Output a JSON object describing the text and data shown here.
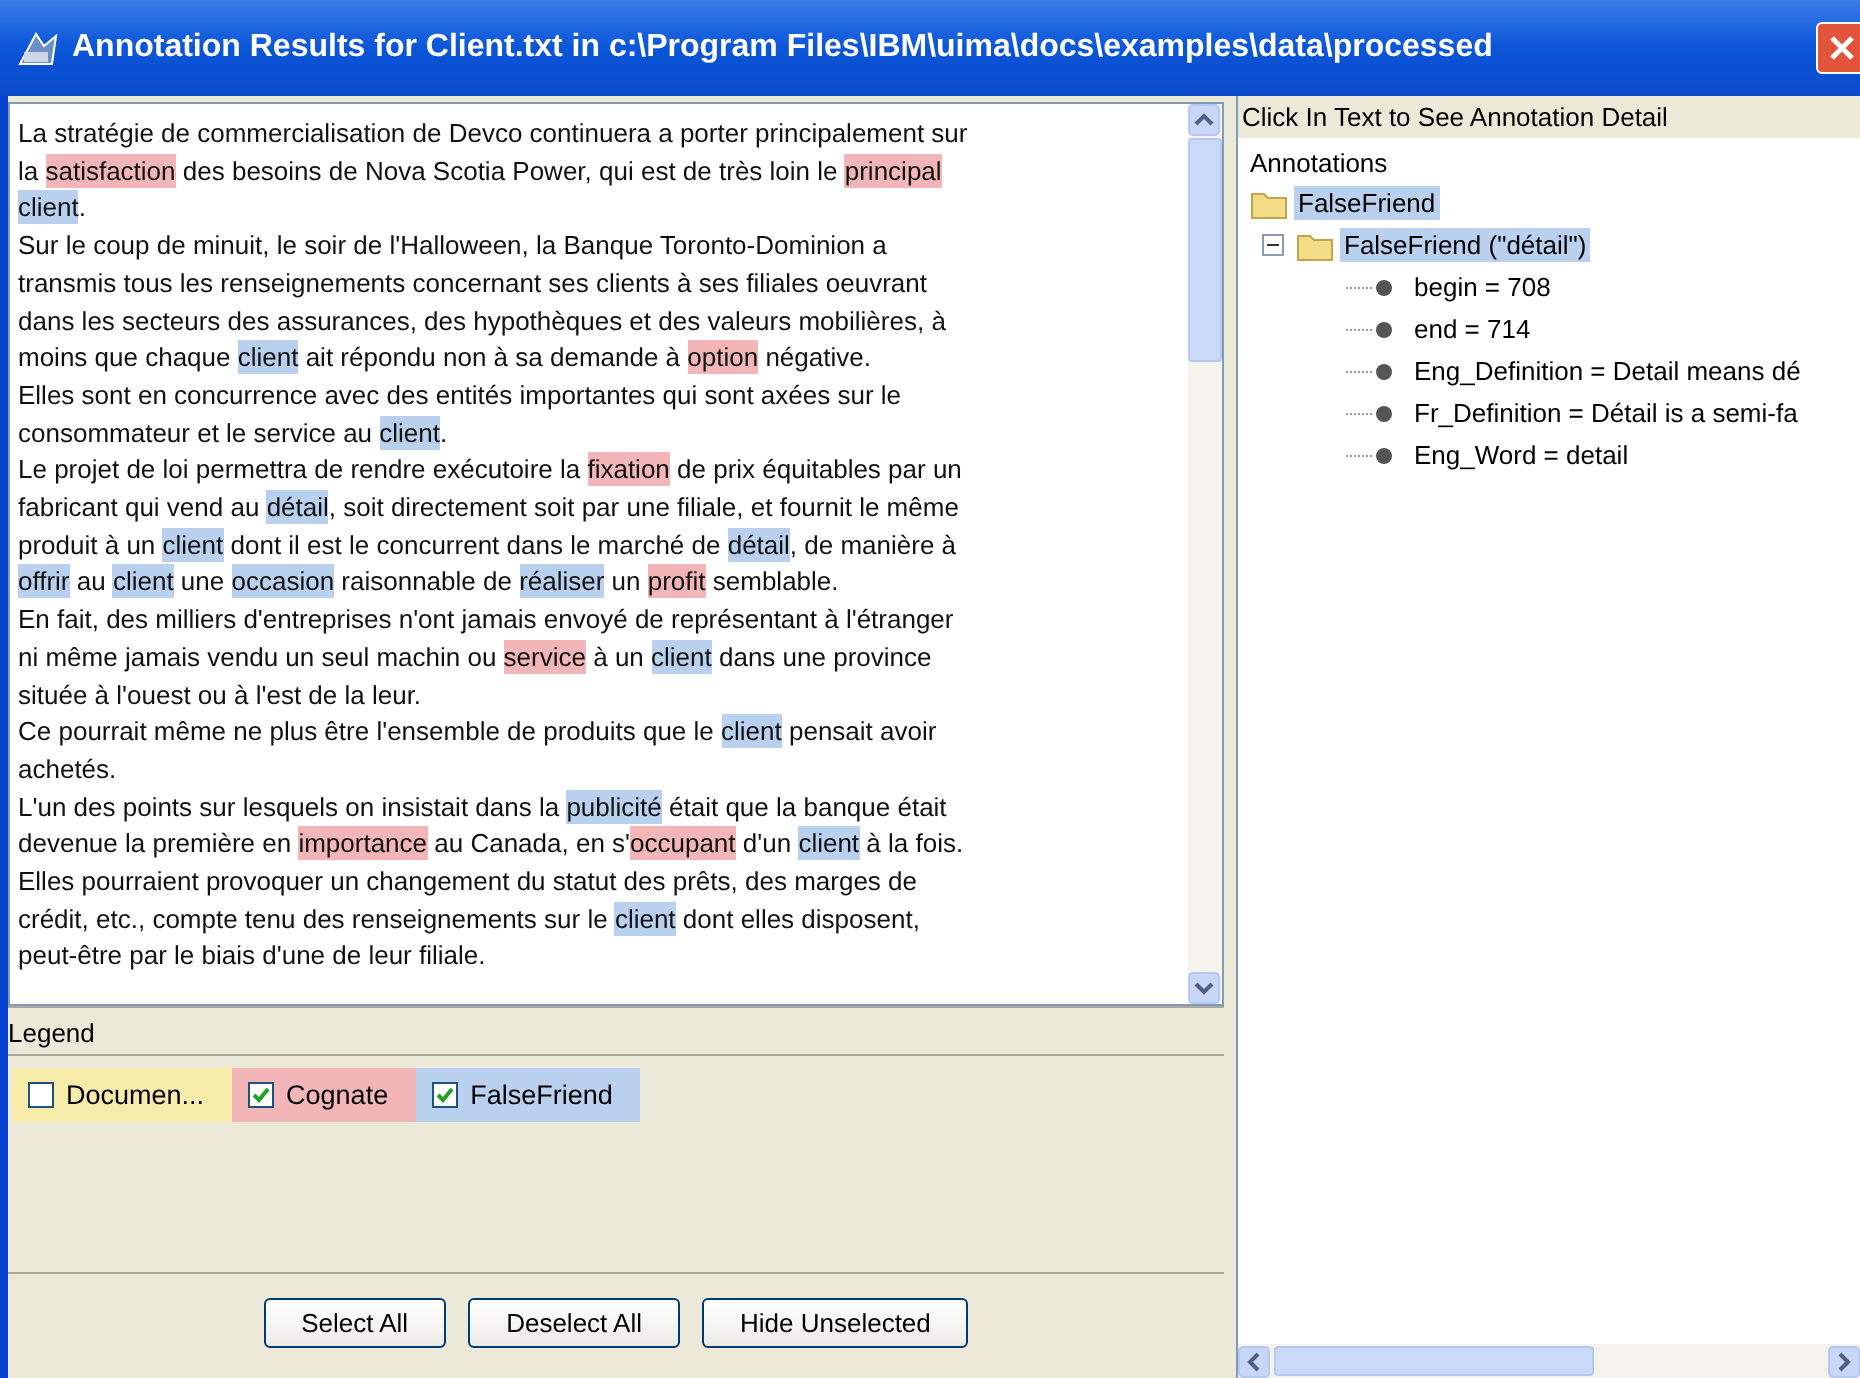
{
  "window": {
    "title": "Annotation Results for Client.txt in c:\\Program Files\\IBM\\uima\\docs\\examples\\data\\processed"
  },
  "document": {
    "lines": [
      [
        {
          "text": "La stratégie de commercialisation de Devco continuera a porter principalement sur",
          "kind": "plain"
        }
      ],
      [
        {
          "text": "la ",
          "kind": "plain"
        },
        {
          "text": "satisfaction",
          "kind": "cognate"
        },
        {
          "text": " des besoins de Nova Scotia Power, qui est de très loin le ",
          "kind": "plain"
        },
        {
          "text": "principal",
          "kind": "cognate"
        }
      ],
      [
        {
          "text": "client",
          "kind": "false_friend"
        },
        {
          "text": ".",
          "kind": "plain"
        }
      ],
      [
        {
          "text": "Sur le coup de minuit, le soir de l'Halloween, la Banque Toronto-Dominion a",
          "kind": "plain"
        }
      ],
      [
        {
          "text": "transmis tous les renseignements concernant ses clients à ses filiales oeuvrant",
          "kind": "plain"
        }
      ],
      [
        {
          "text": "dans les secteurs des assurances, des hypothèques et des valeurs mobilières, à",
          "kind": "plain"
        }
      ],
      [
        {
          "text": "moins que chaque ",
          "kind": "plain"
        },
        {
          "text": "client",
          "kind": "false_friend"
        },
        {
          "text": " ait répondu non à sa demande à ",
          "kind": "plain"
        },
        {
          "text": "option",
          "kind": "cognate"
        },
        {
          "text": " négative.",
          "kind": "plain"
        }
      ],
      [
        {
          "text": "Elles sont en concurrence avec des entités importantes qui sont axées sur le",
          "kind": "plain"
        }
      ],
      [
        {
          "text": "consommateur et le service au ",
          "kind": "plain"
        },
        {
          "text": "client",
          "kind": "false_friend"
        },
        {
          "text": ".",
          "kind": "plain"
        }
      ],
      [
        {
          "text": "Le projet de loi permettra de rendre exécutoire la ",
          "kind": "plain"
        },
        {
          "text": "fixation",
          "kind": "cognate"
        },
        {
          "text": " de prix équitables par un",
          "kind": "plain"
        }
      ],
      [
        {
          "text": "fabricant qui vend au ",
          "kind": "plain"
        },
        {
          "text": "détail",
          "kind": "false_friend"
        },
        {
          "text": ", soit directement soit par une filiale, et fournit le même",
          "kind": "plain"
        }
      ],
      [
        {
          "text": "produit à un ",
          "kind": "plain"
        },
        {
          "text": "client",
          "kind": "false_friend"
        },
        {
          "text": " dont il est le concurrent dans le marché de ",
          "kind": "plain"
        },
        {
          "text": "détail",
          "kind": "false_friend"
        },
        {
          "text": ", de manière à",
          "kind": "plain"
        }
      ],
      [
        {
          "text": "offrir",
          "kind": "false_friend"
        },
        {
          "text": " au ",
          "kind": "plain"
        },
        {
          "text": "client",
          "kind": "false_friend"
        },
        {
          "text": " une ",
          "kind": "plain"
        },
        {
          "text": "occasion",
          "kind": "false_friend"
        },
        {
          "text": " raisonnable de ",
          "kind": "plain"
        },
        {
          "text": "réaliser",
          "kind": "false_friend"
        },
        {
          "text": " un ",
          "kind": "plain"
        },
        {
          "text": "profit",
          "kind": "cognate"
        },
        {
          "text": " semblable.",
          "kind": "plain"
        }
      ],
      [
        {
          "text": "En fait, des milliers d'entreprises n'ont jamais envoyé de représentant à l'étranger",
          "kind": "plain"
        }
      ],
      [
        {
          "text": "ni même jamais vendu un seul machin ou ",
          "kind": "plain"
        },
        {
          "text": "service",
          "kind": "cognate"
        },
        {
          "text": " à un ",
          "kind": "plain"
        },
        {
          "text": "client",
          "kind": "false_friend"
        },
        {
          "text": " dans une province",
          "kind": "plain"
        }
      ],
      [
        {
          "text": "située à l'ouest ou à l'est de la leur.",
          "kind": "plain"
        }
      ],
      [
        {
          "text": "Ce pourrait même ne plus être l'ensemble de produits que le ",
          "kind": "plain"
        },
        {
          "text": "client",
          "kind": "false_friend"
        },
        {
          "text": " pensait avoir",
          "kind": "plain"
        }
      ],
      [
        {
          "text": "achetés.",
          "kind": "plain"
        }
      ],
      [
        {
          "text": "L'un des points sur lesquels on insistait dans la ",
          "kind": "plain"
        },
        {
          "text": "publicité",
          "kind": "false_friend"
        },
        {
          "text": " était que la banque était",
          "kind": "plain"
        }
      ],
      [
        {
          "text": "devenue la première en ",
          "kind": "plain"
        },
        {
          "text": "importance",
          "kind": "cognate"
        },
        {
          "text": " au Canada, en s'",
          "kind": "plain"
        },
        {
          "text": "occupant",
          "kind": "cognate"
        },
        {
          "text": " d'un ",
          "kind": "plain"
        },
        {
          "text": "client",
          "kind": "false_friend"
        },
        {
          "text": " à la fois.",
          "kind": "plain"
        }
      ],
      [
        {
          "text": "Elles pourraient provoquer un changement du statut des prêts, des marges de",
          "kind": "plain"
        }
      ],
      [
        {
          "text": "crédit, etc., compte tenu des renseignements sur le ",
          "kind": "plain"
        },
        {
          "text": "client",
          "kind": "false_friend"
        },
        {
          "text": " dont elles disposent,",
          "kind": "plain"
        }
      ],
      [
        {
          "text": "peut-être par le biais d'une de leur filiale.",
          "kind": "plain"
        }
      ]
    ]
  },
  "legend": {
    "title": "Legend",
    "items": [
      {
        "label": "Documen...",
        "checked": false,
        "color": "#f6eba8"
      },
      {
        "label": "Cognate",
        "checked": true,
        "color": "#f2b6b8"
      },
      {
        "label": "FalseFriend",
        "checked": true,
        "color": "#b9d1ef"
      }
    ]
  },
  "buttons": [
    "Select All",
    "Deselect All",
    "Hide Unselected"
  ],
  "annotations": {
    "header": "Click In Text to See Annotation Detail",
    "root": "Annotations",
    "children": [
      {
        "label": "FalseFriend",
        "selected": true,
        "children": [
          {
            "label": "FalseFriend (\"détail\")",
            "selected": true,
            "expanded": true,
            "children": [
              {
                "label": "begin = 708",
                "selected": false
              },
              {
                "label": "end = 714",
                "selected": false
              },
              {
                "label": "Eng_Definition = Detail means dé",
                "selected": false
              },
              {
                "label": "Fr_Definition = Détail is a semi-fa",
                "selected": false
              },
              {
                "label": "Eng_Word = detail",
                "selected": false
              }
            ]
          }
        ]
      }
    ]
  }
}
